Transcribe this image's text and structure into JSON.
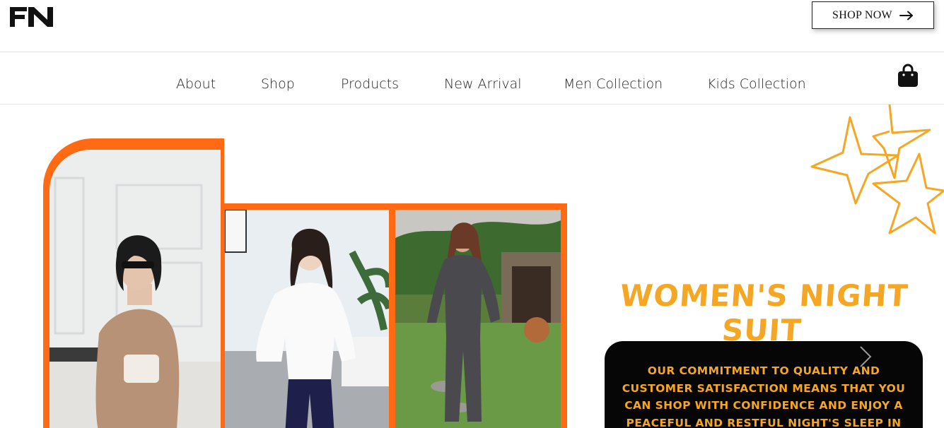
{
  "brand": {
    "logo_text": "FN"
  },
  "header": {
    "shop_now_label": "SHOP NOW"
  },
  "nav": {
    "items": [
      {
        "label": "About"
      },
      {
        "label": "Shop"
      },
      {
        "label": "Products"
      },
      {
        "label": "New Arrival"
      },
      {
        "label": "Men Collection"
      },
      {
        "label": "Kids Collection"
      }
    ],
    "cart_icon": "shopping-bag-icon"
  },
  "hero": {
    "title": "WOMEN'S NIGHT SUIT",
    "description": "OUR COMMITMENT TO QUALITY AND CUSTOMER SATISFACTION MEANS THAT YOU CAN SHOP WITH CONFIDENCE AND ENJOY A PEACEFUL AND RESTFUL NIGHT'S SLEEP IN OUR",
    "next_icon": "chevron-right-icon"
  },
  "colors": {
    "accent_orange": "#ff6a13",
    "title_gold": "#f5a623",
    "box_black": "#060606"
  }
}
